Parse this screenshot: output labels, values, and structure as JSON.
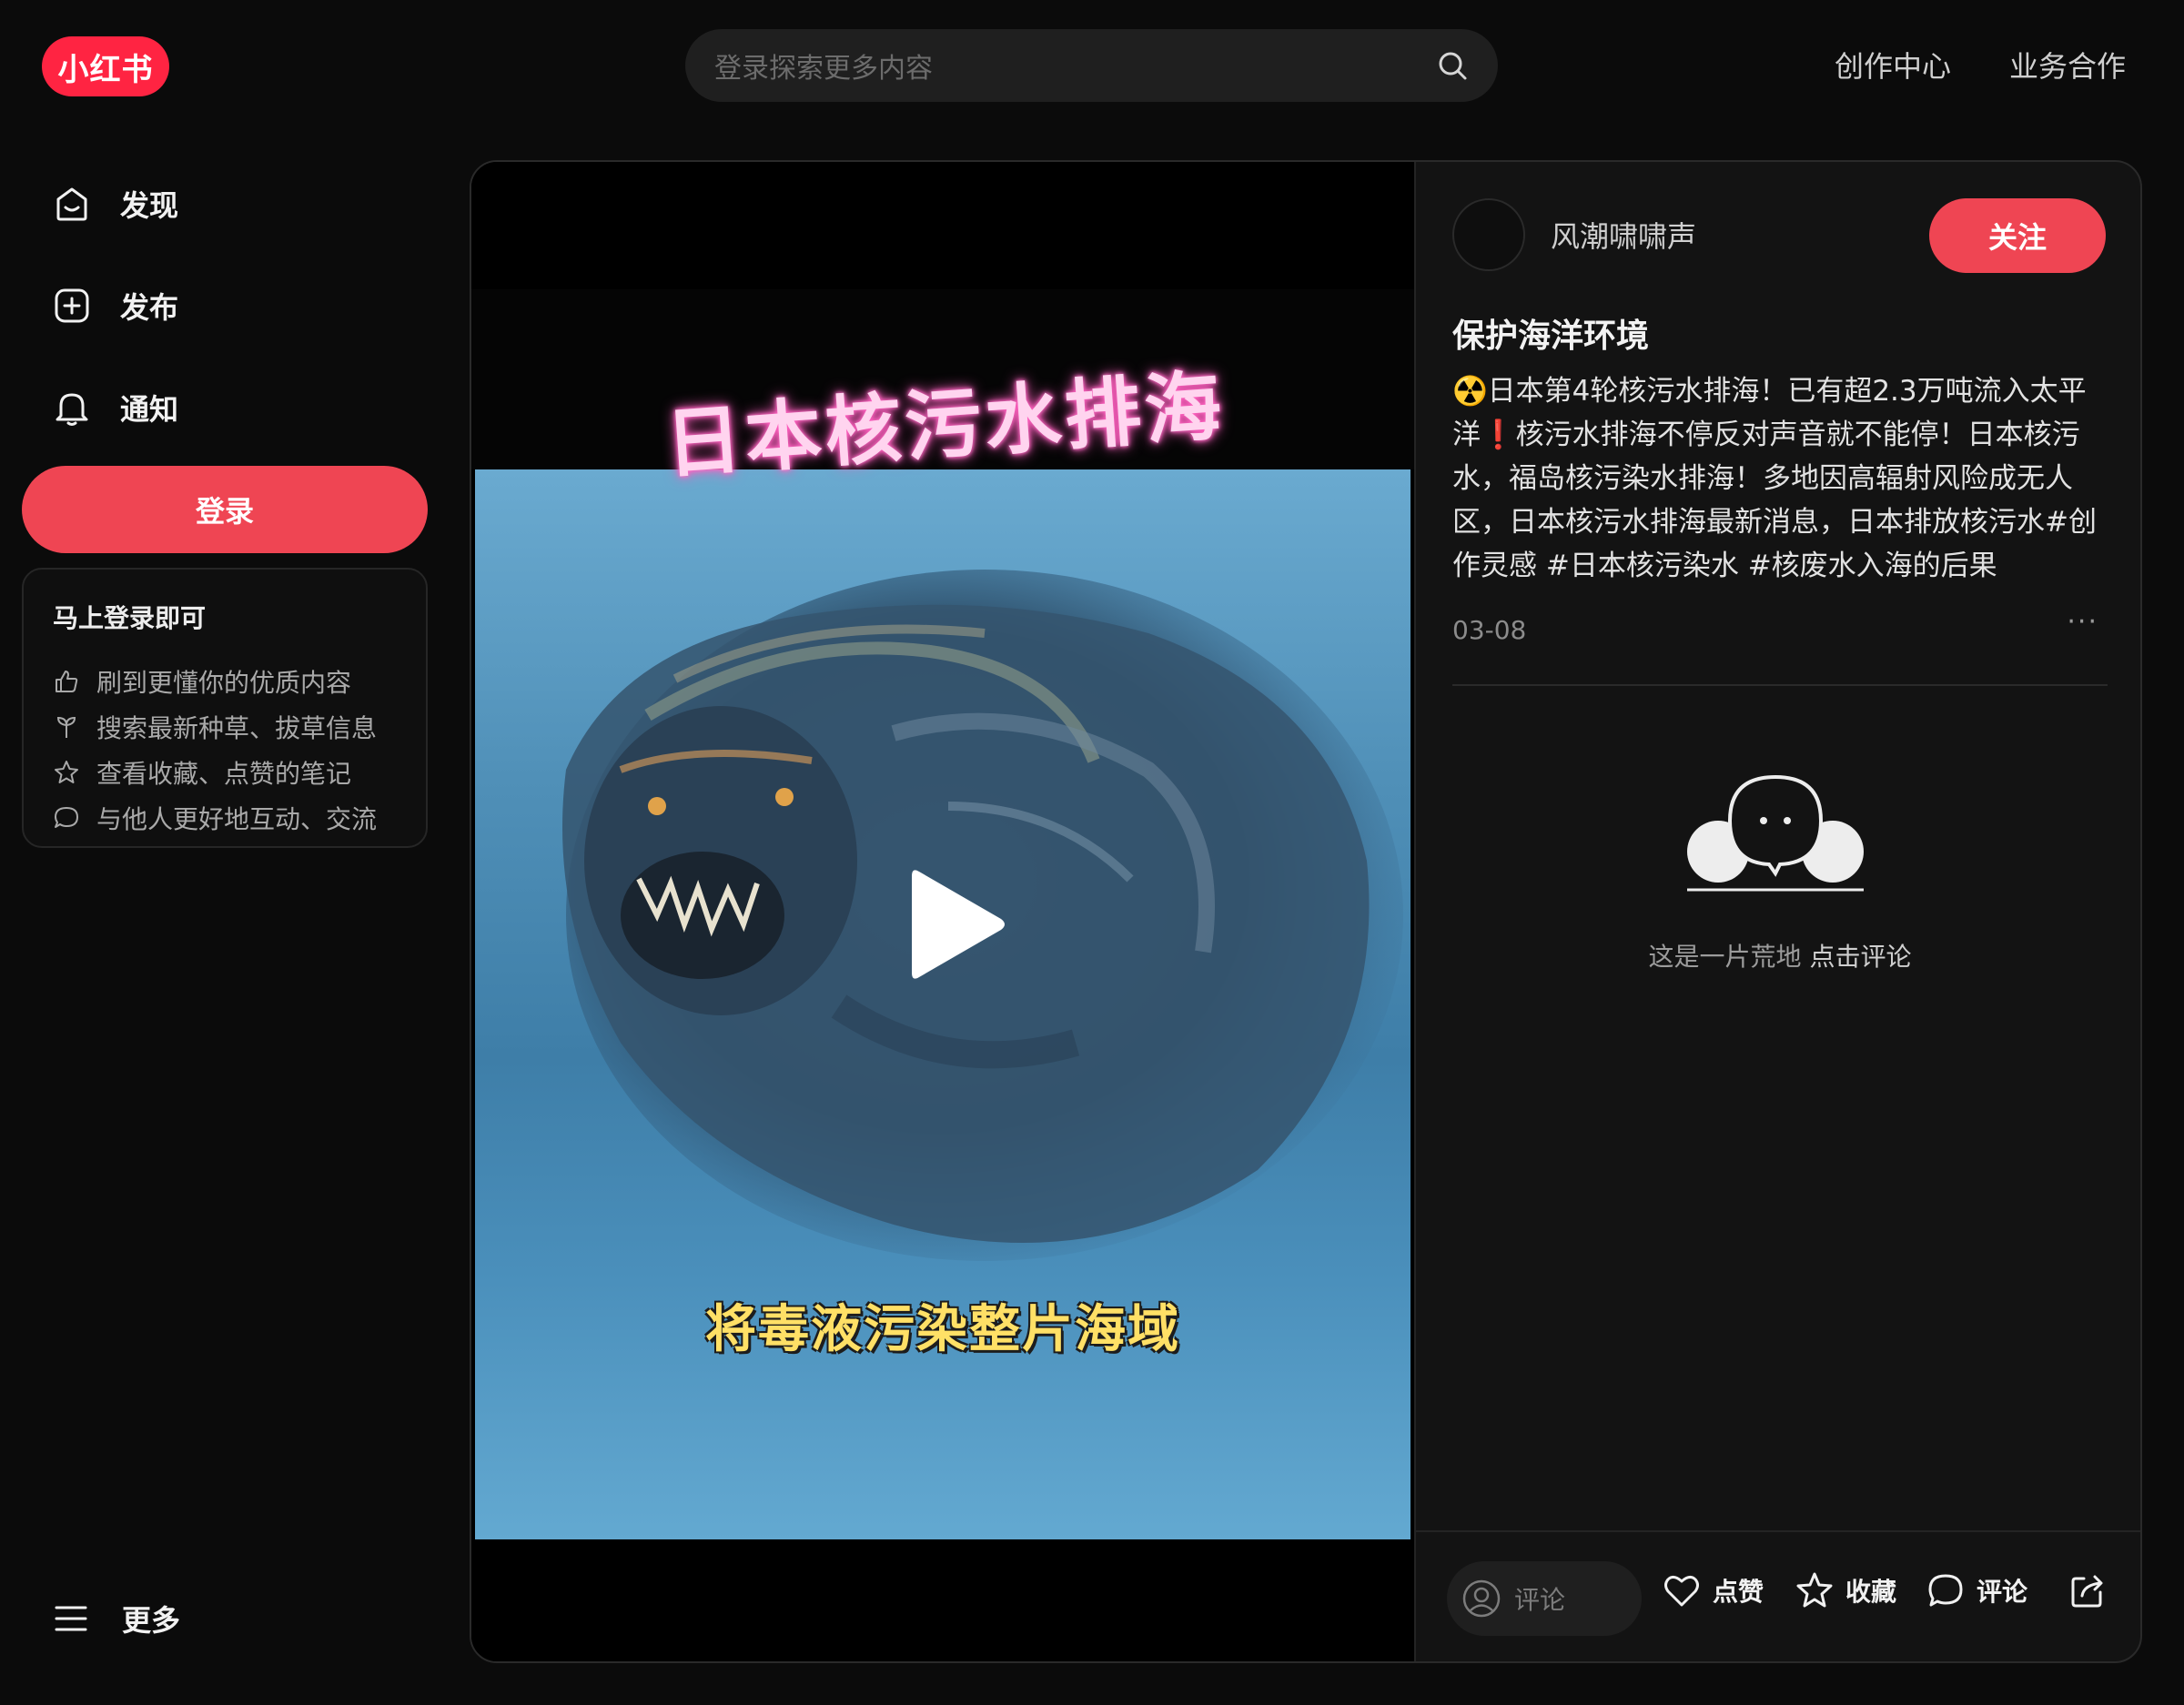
{
  "header": {
    "logo_text": "小红书",
    "search_placeholder": "登录探索更多内容",
    "nav": [
      "创作中心",
      "业务合作"
    ]
  },
  "sidebar": {
    "items": [
      {
        "label": "发现",
        "icon": "home-icon"
      },
      {
        "label": "发布",
        "icon": "plus-square-icon"
      },
      {
        "label": "通知",
        "icon": "bell-icon"
      }
    ],
    "login_button": "登录",
    "login_card": {
      "title": "马上登录即可",
      "benefits": [
        {
          "text": "刷到更懂你的优质内容",
          "icon": "thumbs-up-icon"
        },
        {
          "text": "搜索最新种草、拔草信息",
          "icon": "sprout-icon"
        },
        {
          "text": "查看收藏、点赞的笔记",
          "icon": "star-icon"
        },
        {
          "text": "与他人更好地互动、交流",
          "icon": "chat-bubble-icon"
        }
      ]
    },
    "more_label": "更多"
  },
  "video": {
    "overlay_title": "日本核污水排海",
    "overlay_subtitle": "将毒液污染整片海域"
  },
  "note": {
    "author": "风潮啸啸声",
    "follow_label": "关注",
    "title": "保护海洋环境",
    "desc_part1": "☢️日本第4轮核污水排海！已有超2.3万吨流入太平洋❗核污水排海不停反对声音就不能停！日本核污水，福岛核污染水排海！多地因高辐射风险成无人区，日本核污水排海最新消息，日本排放核污水",
    "hashtags": [
      "#创作灵感",
      "#日本核污染水",
      "#核废水入海的后果"
    ],
    "date": "03-08",
    "more": "···"
  },
  "comments": {
    "empty_text": "这是一片荒地",
    "empty_link": "点击评论",
    "input_placeholder": "评论"
  },
  "actions": {
    "like": "点赞",
    "collect": "收藏",
    "comment": "评论"
  },
  "colors": {
    "brand_red": "#ff2442",
    "button_red": "#ef4553",
    "background": "#0b0b0b",
    "panel": "#131313"
  }
}
